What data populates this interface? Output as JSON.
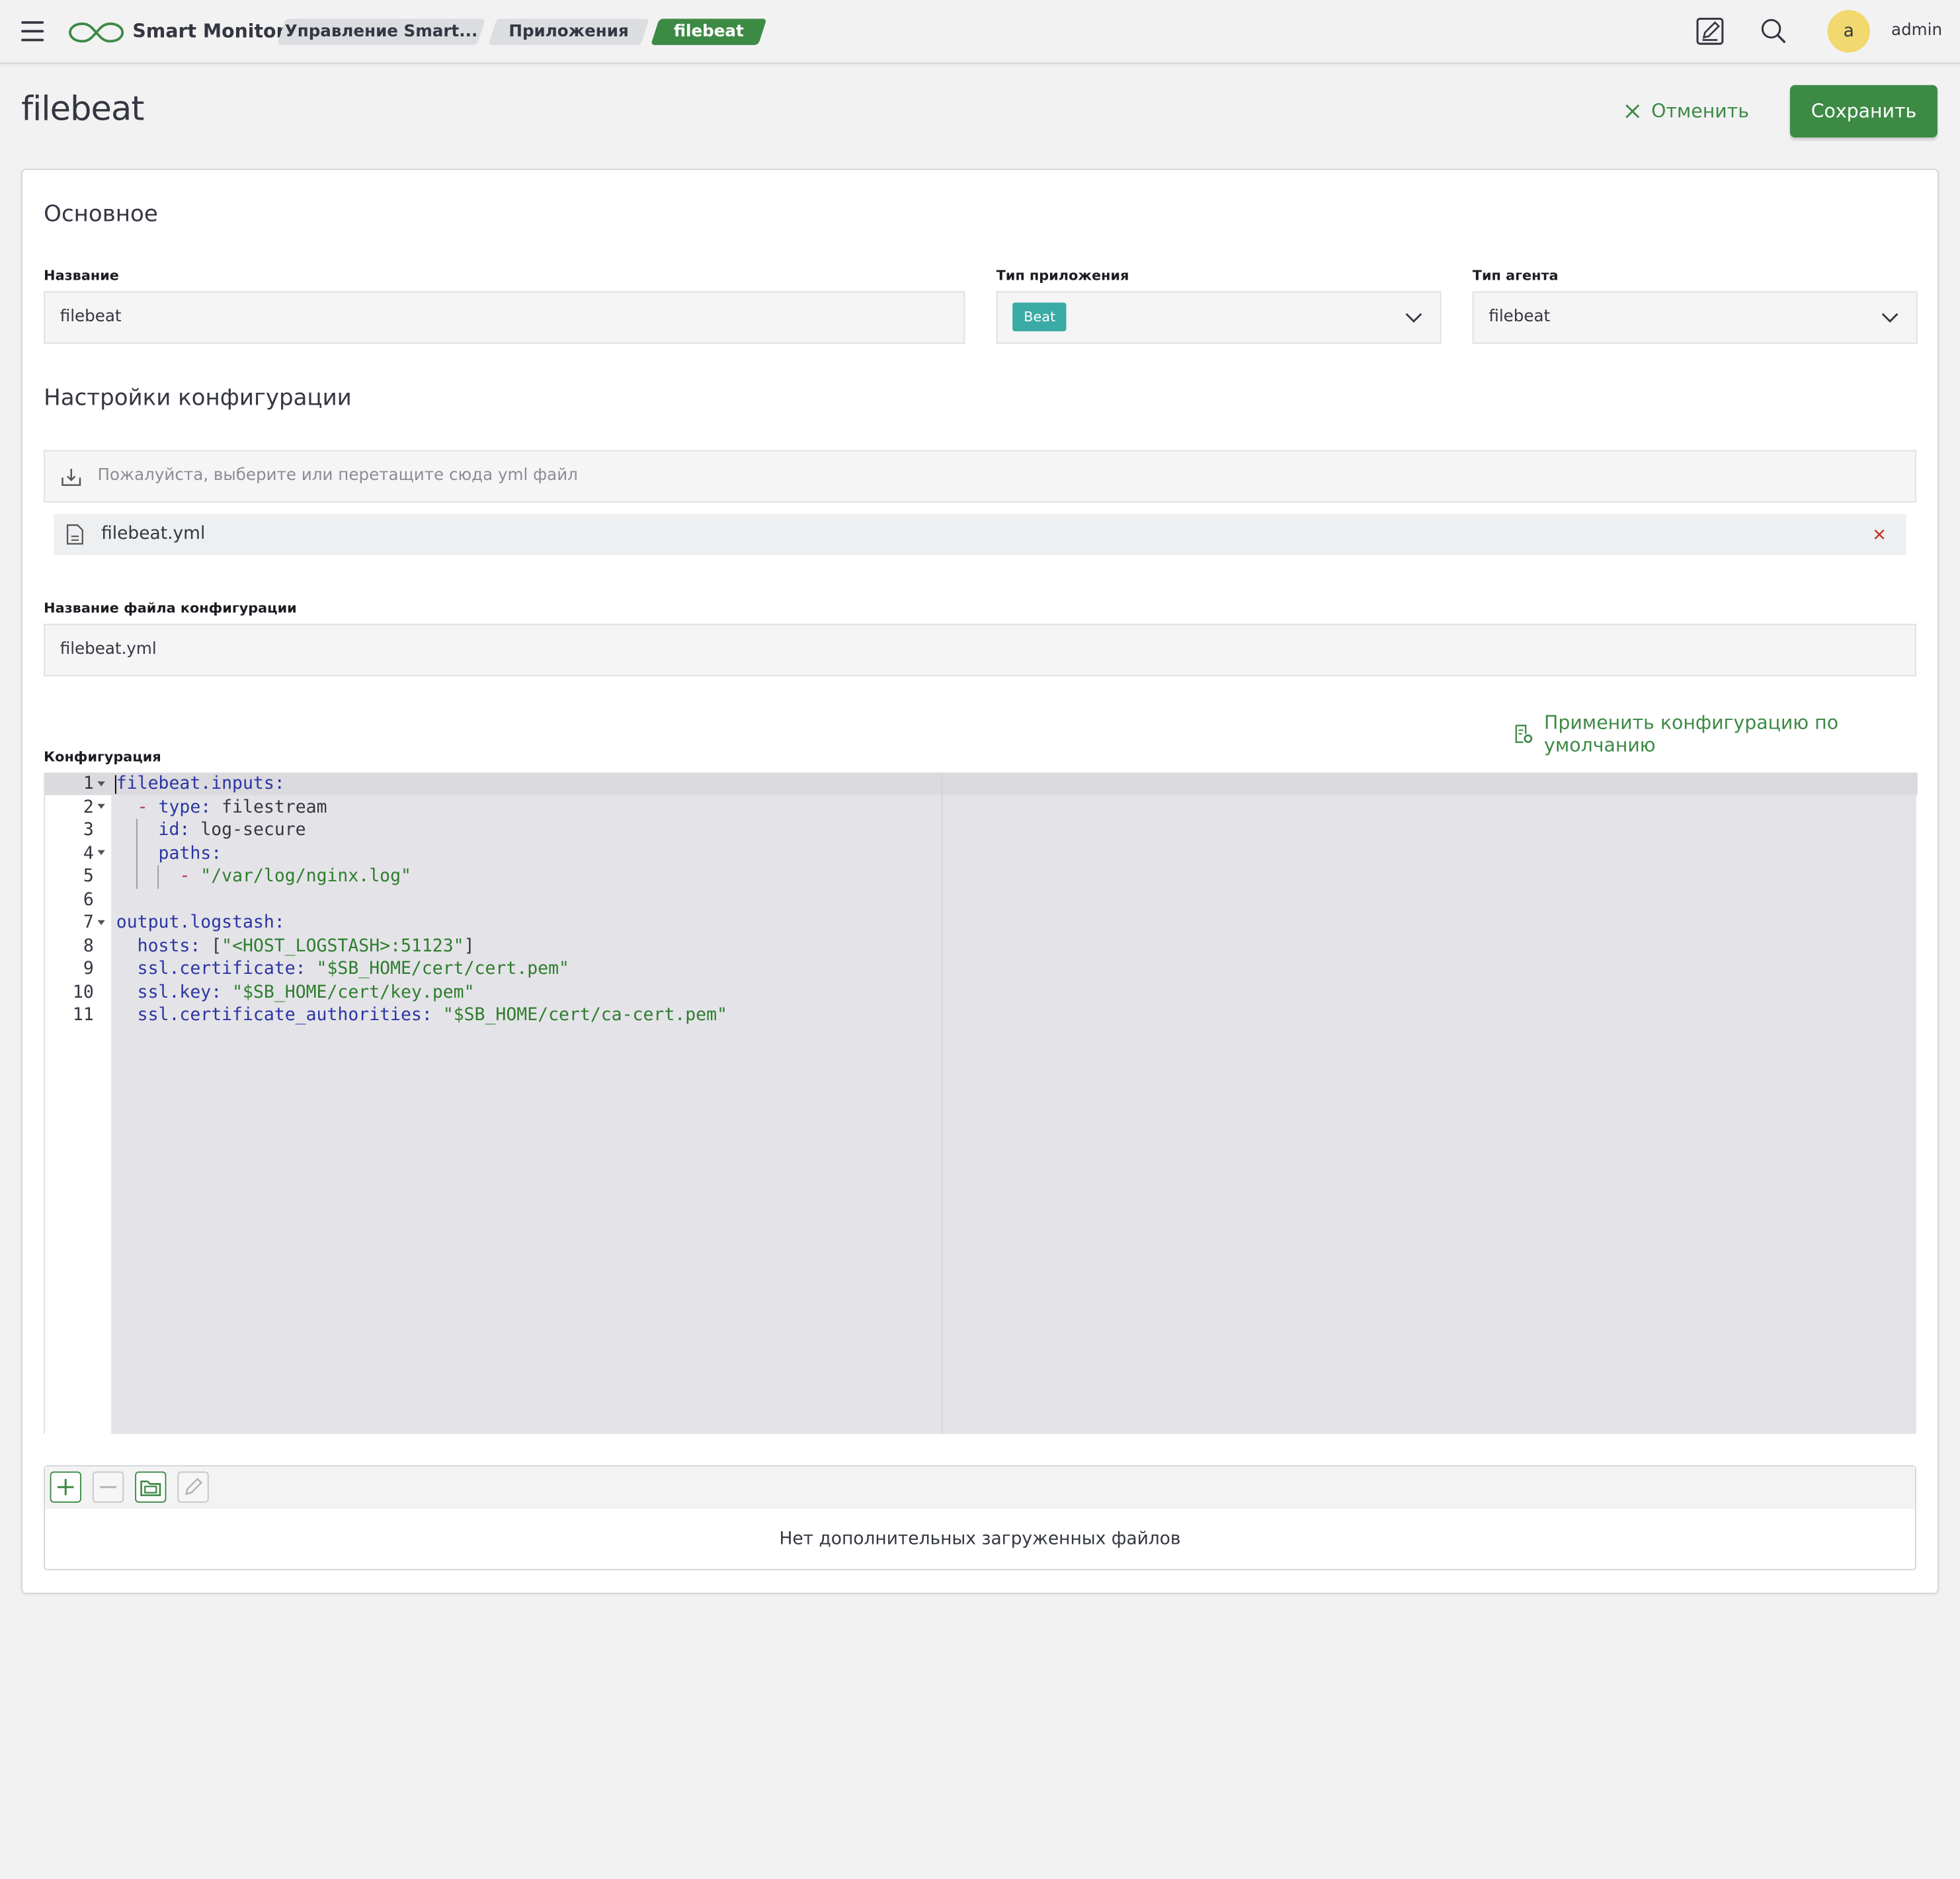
{
  "app": {
    "brand": "Smart Monitor",
    "user_initial": "a",
    "username": "admin"
  },
  "breadcrumbs": [
    {
      "label": "Управление Smart..."
    },
    {
      "label": "Приложения"
    },
    {
      "label": "filebeat"
    }
  ],
  "header": {
    "title": "filebeat",
    "cancel_label": "Отменить",
    "save_label": "Сохранить"
  },
  "main_section": {
    "title": "Основное",
    "name_label": "Название",
    "name_value": "filebeat",
    "app_type_label": "Тип приложения",
    "app_type_value": "Beat",
    "agent_type_label": "Тип агента",
    "agent_type_value": "filebeat"
  },
  "config_section": {
    "title": "Настройки конфигурации",
    "dropzone_placeholder": "Пожалуйста, выберите или перетащите сюда yml файл",
    "uploaded_file": "filebeat.yml",
    "filename_label": "Название файла конфигурации",
    "filename_value": "filebeat.yml",
    "apply_default_label": "Применить конфигурацию по умолчанию",
    "config_label": "Конфигурация",
    "code_lines": [
      "filebeat.inputs:",
      "  - type: filestream",
      "    id: log-secure",
      "    paths:",
      "      - \"/var/log/nginx.log\"",
      "",
      "output.logstash:",
      "  hosts: [\"<HOST_LOGSTASH>:51123\"]",
      "  ssl.certificate: \"$SB_HOME/cert/cert.pem\"",
      "  ssl.key: \"$SB_HOME/cert/key.pem\"",
      "  ssl.certificate_authorities: \"$SB_HOME/cert/ca-cert.pem\""
    ],
    "line_numbers": [
      "1",
      "2",
      "3",
      "4",
      "5",
      "6",
      "7",
      "8",
      "9",
      "10",
      "11"
    ]
  },
  "extra_files": {
    "empty_text": "Нет дополнительных загруженных файлов"
  },
  "colors": {
    "accent": "#3d8a45",
    "badge": "#3aaaa4",
    "avatar": "#f1d86f"
  }
}
